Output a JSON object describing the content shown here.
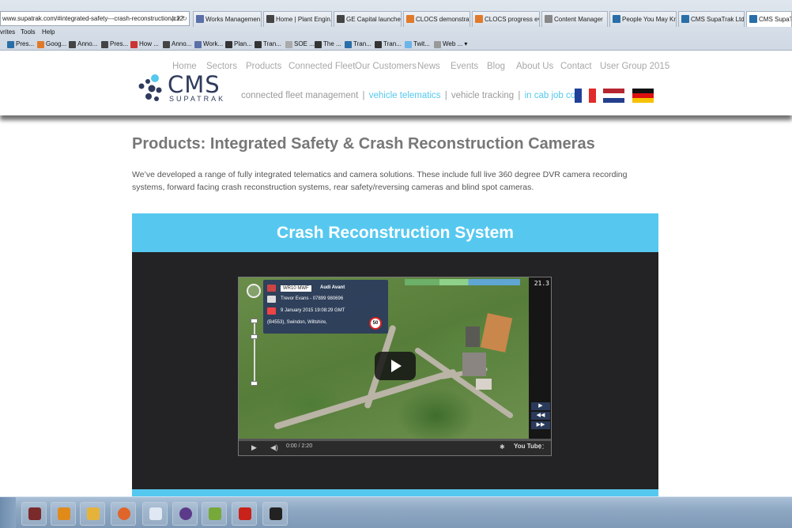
{
  "browser": {
    "address": "www.supatrak.com/#integrated-safety---crash-reconstruction/c22",
    "address_buttons": "ρ ▾ ↻",
    "tabs": [
      {
        "label": "Works Managemen...",
        "color": "#5b6fa8"
      },
      {
        "label": "Home | Plant Engin...",
        "color": "#444"
      },
      {
        "label": "GE Capital launches...",
        "color": "#444"
      },
      {
        "label": "CLOCS demonstrati...",
        "color": "#e07a2a"
      },
      {
        "label": "CLOCS progress ev...",
        "color": "#e07a2a"
      },
      {
        "label": "Content Manager",
        "color": "#888"
      },
      {
        "label": "People You May Kn...",
        "color": "#2a6ea8"
      },
      {
        "label": "CMS SupaTrak Ltd |...",
        "color": "#2a6ea8"
      },
      {
        "label": "CMS SupaTr",
        "color": "#2a6ea8"
      }
    ],
    "menu": [
      "vrites",
      "Tools",
      "Help"
    ],
    "favorites": [
      {
        "label": "Pres...",
        "color": "#2a6ea8"
      },
      {
        "label": "Goog...",
        "color": "#e07a2a"
      },
      {
        "label": "Anno...",
        "color": "#444"
      },
      {
        "label": "Pres...",
        "color": "#444"
      },
      {
        "label": "How ...",
        "color": "#c33"
      },
      {
        "label": "Anno...",
        "color": "#444"
      },
      {
        "label": "Work...",
        "color": "#5b6fa8"
      },
      {
        "label": "Plan...",
        "color": "#333"
      },
      {
        "label": "Tran...",
        "color": "#333"
      },
      {
        "label": "SOE ...",
        "color": "#aaa"
      },
      {
        "label": "The ...",
        "color": "#333"
      },
      {
        "label": "Tran...",
        "color": "#2a6ea8"
      },
      {
        "label": "Tran...",
        "color": "#333"
      },
      {
        "label": "Twit...",
        "color": "#6bb5e8"
      },
      {
        "label": "Web ... ▾",
        "color": "#999"
      }
    ]
  },
  "site": {
    "nav": [
      "Home",
      "Sectors",
      "Products",
      "Connected Fleet",
      "Our Customers",
      "News",
      "Events",
      "Blog",
      "About Us",
      "Contact",
      "User Group 2015"
    ],
    "logo_text": "CMS",
    "logo_sub": "SUPATRAK",
    "tagline": {
      "part1": "connected fleet management",
      "sep": "|",
      "part2": "vehicle telematics",
      "part3": "vehicle tracking",
      "part4": "in cab job control"
    },
    "flags": [
      "french-flag",
      "dutch-flag",
      "german-flag"
    ]
  },
  "page": {
    "title": "Products: Integrated Safety & Crash Reconstruction Cameras",
    "intro": "We’ve developed a range of fully integrated telematics and camera solutions. These include full live 360 degree DVR camera recording systems, forward facing crash reconstruction systems, rear safety/reversing cameras and blind spot cameras.",
    "section_heading": "Crash Reconstruction System"
  },
  "video": {
    "plate": "WR10 MWF",
    "vehicle": "Audi Avant",
    "driver": "Trevor Evans - 07899 980696",
    "datetime": "9 January 2015 19:08:29 GMT",
    "location": "(B4553), Swindon, Wiltshire,",
    "speed_limit": "50",
    "timer": "21.3",
    "time_display": "0:00 / 2:20",
    "youtube_label": "You Tube",
    "progress": 0.0,
    "duration_seconds": 140,
    "current_seconds": 0
  },
  "taskbar": {
    "items": [
      {
        "icon": "media-center-icon",
        "color": "#7a2a2a"
      },
      {
        "icon": "media-player-icon",
        "color": "#e08a1a"
      },
      {
        "icon": "explorer-icon",
        "color": "#e6b33a"
      },
      {
        "icon": "firefox-icon",
        "color": "#e0652a"
      },
      {
        "icon": "notepad-icon",
        "color": "#dfe8f3"
      },
      {
        "icon": "disc-burner-icon",
        "color": "#5c3a8a"
      },
      {
        "icon": "phone-app-icon",
        "color": "#76a83a"
      },
      {
        "icon": "pdf-reader-icon",
        "color": "#c8221a"
      },
      {
        "icon": "terminal-icon",
        "color": "#222"
      }
    ]
  }
}
